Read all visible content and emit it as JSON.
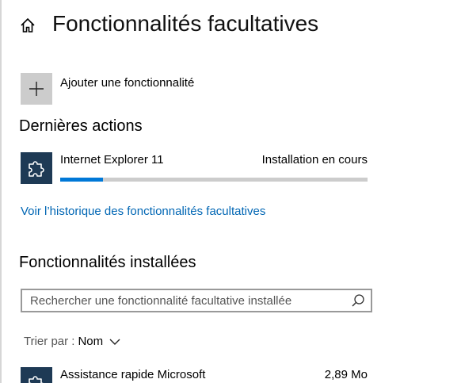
{
  "header": {
    "title": "Fonctionnalités facultatives",
    "home_icon": "home-icon"
  },
  "add_feature": {
    "label": "Ajouter une fonctionnalité",
    "icon": "plus-icon"
  },
  "recent_actions": {
    "title": "Dernières actions",
    "items": [
      {
        "name": "Internet Explorer 11",
        "status": "Installation en cours",
        "icon": "puzzle-icon",
        "progress": 0.14
      }
    ],
    "history_link": "Voir l’historique des fonctionnalités facultatives"
  },
  "installed": {
    "title": "Fonctionnalités installées",
    "search_placeholder": "Rechercher une fonctionnalité facultative installée",
    "search_value": "",
    "sort_label": "Trier par :",
    "sort_value": "Nom",
    "items": [
      {
        "name": "Assistance rapide Microsoft",
        "size": "2,89 Mo",
        "icon": "puzzle-icon"
      }
    ]
  },
  "colors": {
    "accent": "#0078d7",
    "link": "#0066b4",
    "tile": "#1e3a55",
    "add_tile": "#cccccc"
  }
}
